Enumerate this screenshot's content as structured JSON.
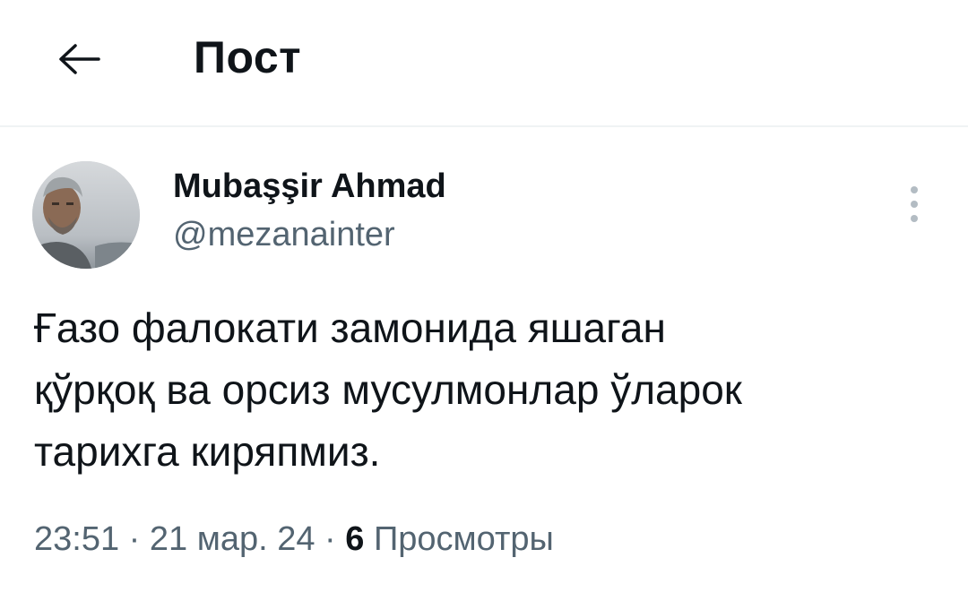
{
  "header": {
    "title": "Пост",
    "back_icon": "arrow-left-icon"
  },
  "author": {
    "display_name": "Mubaşşir Ahmad",
    "handle": "@mezanainter",
    "avatar": "avatar-photo"
  },
  "tweet": {
    "lines": [
      "Ғазо фалокати замонида яшаган",
      "қўрқоқ ва орсиз мусулмонлар ўларок",
      "тарихга киряпмиз."
    ],
    "time": "23:51",
    "date": "21 мар. 24",
    "separator": "·",
    "views_count": "6",
    "views_label": "Просмотры"
  },
  "colors": {
    "text_primary": "#0f1419",
    "text_secondary": "#536471",
    "divider": "#eff3f4"
  },
  "icons": {
    "more": "more-vertical-icon"
  }
}
